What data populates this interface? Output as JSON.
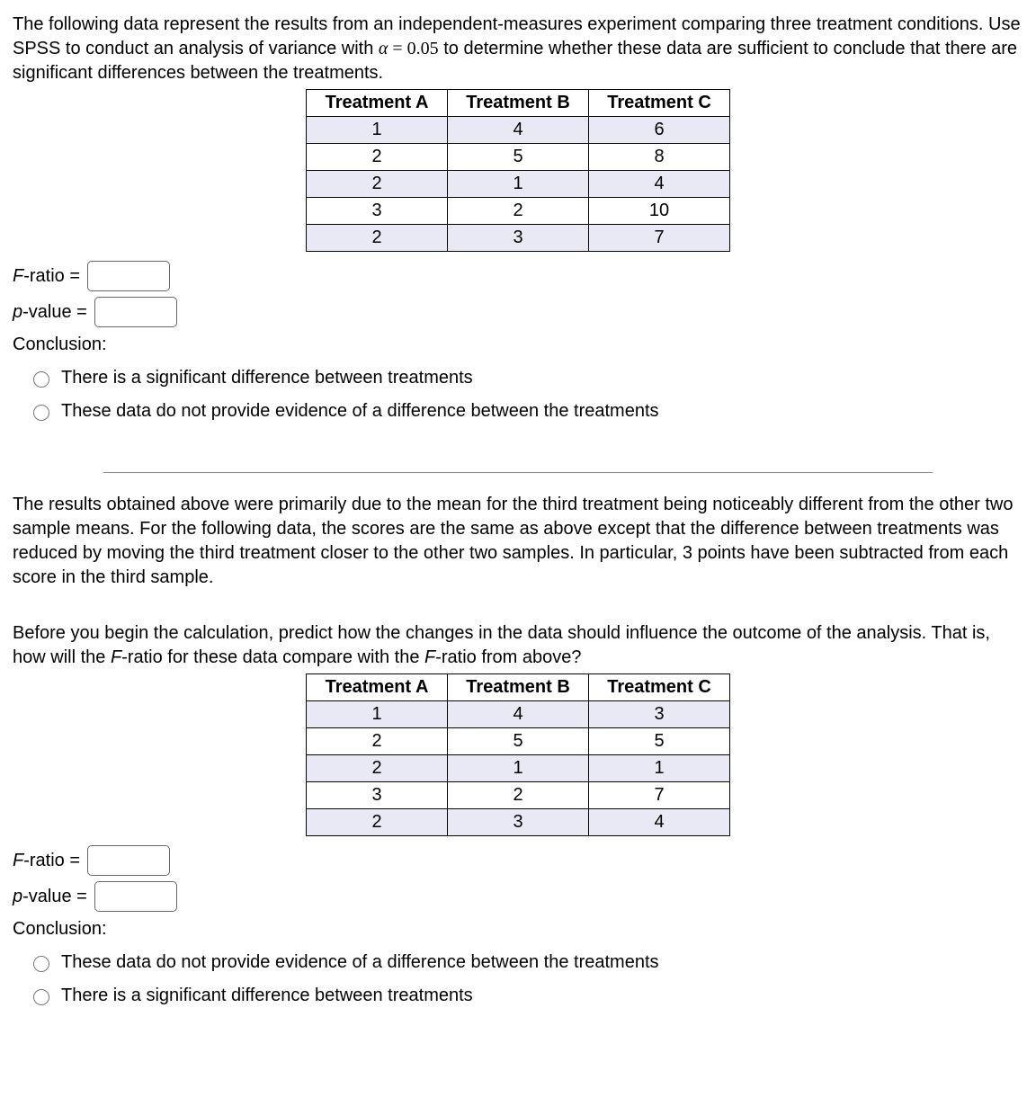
{
  "q1": {
    "intro": "The following data represent the results from an independent-measures experiment comparing three treatment conditions. Use SPSS to conduct an analysis of variance with α = 0.05 to determine whether these data are sufficient to conclude that there are significant differences between the treatments.",
    "table": {
      "headers": [
        "Treatment A",
        "Treatment B",
        "Treatment C"
      ],
      "rows": [
        [
          "1",
          "4",
          "6"
        ],
        [
          "2",
          "5",
          "8"
        ],
        [
          "2",
          "1",
          "4"
        ],
        [
          "3",
          "2",
          "10"
        ],
        [
          "2",
          "3",
          "7"
        ]
      ]
    },
    "f_label": "F-ratio =",
    "p_label": "p-value =",
    "conclusion_label": "Conclusion:",
    "options": [
      "There is a significant difference between treatments",
      "These data do not provide evidence of a difference between the treatments"
    ]
  },
  "q2": {
    "intro1": "The results obtained above were primarily due to the mean for the third treatment being noticeably different from the other two sample means. For the following data, the scores are the same as above except that the difference between treatments was reduced by moving the third treatment closer to the other two samples. In particular, 3 points have been subtracted from each score in the third sample.",
    "intro2": "Before you begin the calculation, predict how the changes in the data should influence the outcome of the analysis. That is, how will the F-ratio for these data compare with the F-ratio from above?",
    "table": {
      "headers": [
        "Treatment A",
        "Treatment B",
        "Treatment C"
      ],
      "rows": [
        [
          "1",
          "4",
          "3"
        ],
        [
          "2",
          "5",
          "5"
        ],
        [
          "2",
          "1",
          "1"
        ],
        [
          "3",
          "2",
          "7"
        ],
        [
          "2",
          "3",
          "4"
        ]
      ]
    },
    "f_label": "F-ratio =",
    "p_label": "p-value =",
    "conclusion_label": "Conclusion:",
    "options": [
      "These data do not provide evidence of a difference between the treatments",
      "There is a significant difference between treatments"
    ]
  }
}
